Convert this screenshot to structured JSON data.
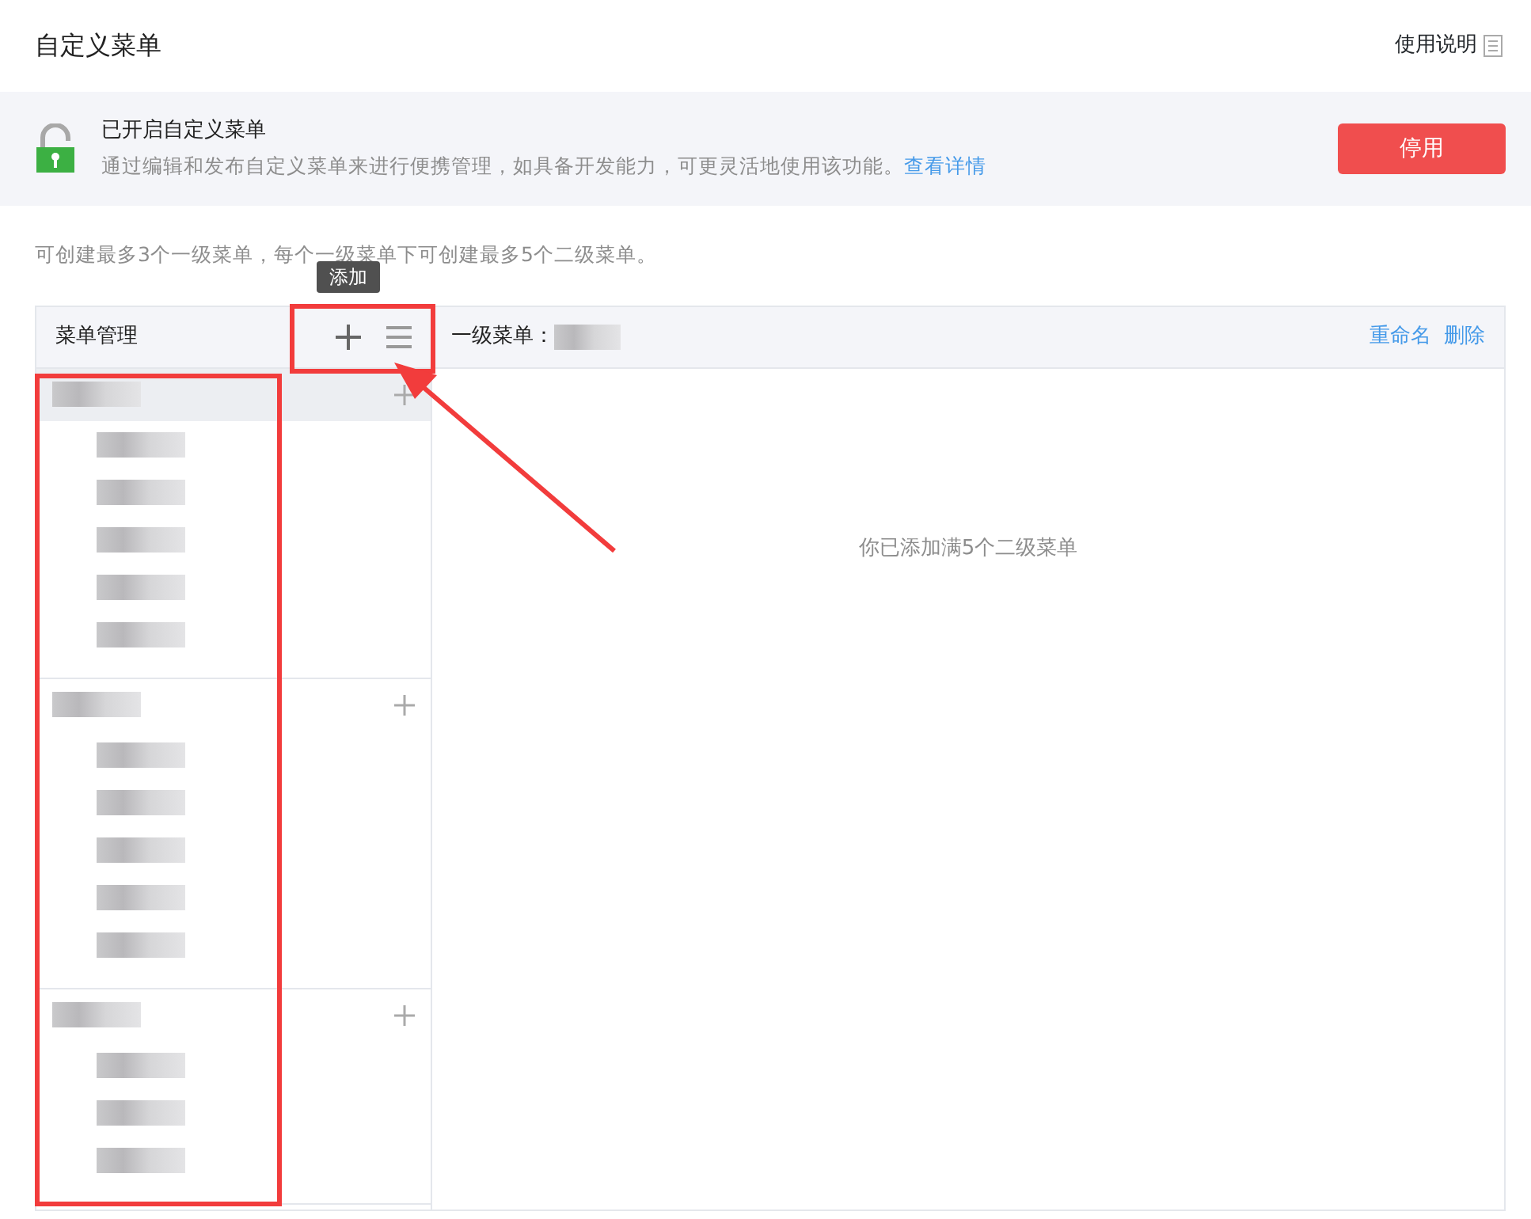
{
  "page_title": "自定义菜单",
  "help_link": "使用说明",
  "status_banner": {
    "title": "已开启自定义菜单",
    "description": "通过编辑和发布自定义菜单来进行便携管理，如具备开发能力，可更灵活地使用该功能。",
    "details_link": "查看详情",
    "button": "停用"
  },
  "notice": "可创建最多3个一级菜单，每个一级菜单下可创建最多5个二级菜单。",
  "menu_panel": {
    "title": "菜单管理",
    "add_tooltip": "添加",
    "menus": [
      {
        "selected": true,
        "children": [
          {
            "kind": "redacted"
          },
          {
            "kind": "redacted"
          },
          {
            "kind": "redacted"
          },
          {
            "kind": "redacted"
          },
          {
            "kind": "redacted"
          }
        ]
      },
      {
        "selected": false,
        "children": [
          {
            "kind": "redacted"
          },
          {
            "kind": "redacted"
          },
          {
            "kind": "redacted"
          },
          {
            "kind": "redacted"
          },
          {
            "kind": "redacted"
          }
        ]
      },
      {
        "selected": false,
        "children": [
          {
            "kind": "redacted"
          },
          {
            "kind": "redacted"
          },
          {
            "kind": "redacted"
          }
        ]
      }
    ]
  },
  "detail": {
    "label": "一级菜单：",
    "rename": "重命名",
    "delete": "删除",
    "message": "你已添加满5个二级菜单"
  }
}
